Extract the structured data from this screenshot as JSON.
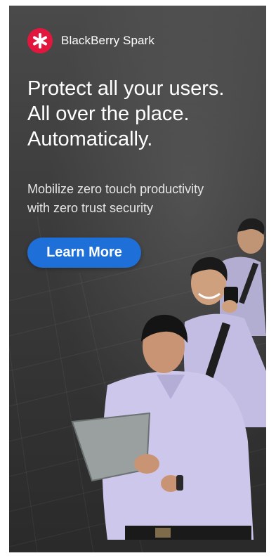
{
  "brand": {
    "name": "BlackBerry Spark",
    "logo_color": "#e3173e"
  },
  "headline": {
    "lines": [
      "Protect all your users.",
      "All over the place.",
      "Automatically."
    ]
  },
  "subhead": {
    "lines": [
      "Mobilize zero touch productivity",
      "with zero trust security"
    ]
  },
  "cta": {
    "label": "Learn More",
    "color": "#1f6fd8"
  },
  "photo": {
    "subject": "three-figures-with-phone-and-tablet"
  }
}
